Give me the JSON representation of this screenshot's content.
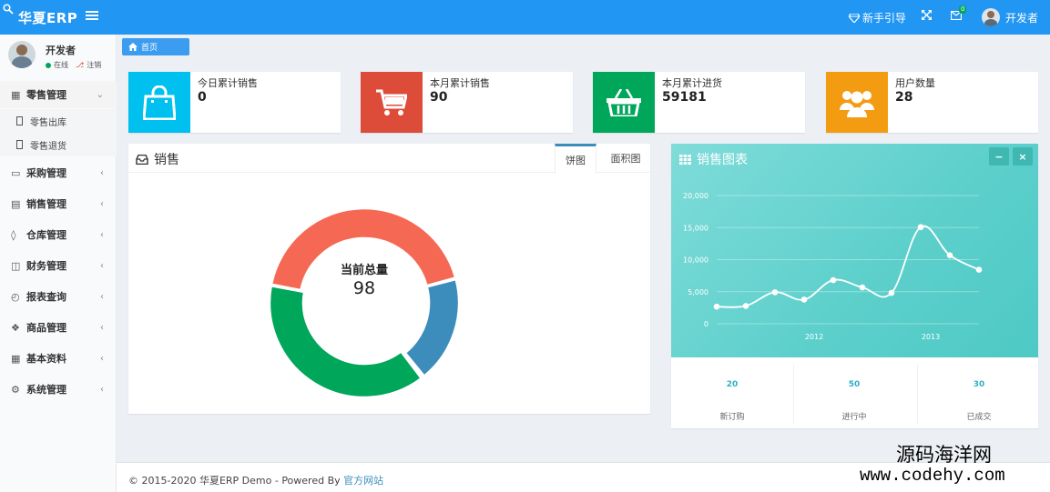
{
  "header": {
    "logo": "华夏ERP",
    "guide_label": "新手引导",
    "mail_badge": "0",
    "user_name": "开发者"
  },
  "sidebar": {
    "user": {
      "name": "开发者",
      "status": "在线",
      "logout": "注销"
    },
    "items": [
      {
        "label": "零售管理",
        "icon": "list-icon",
        "open": true
      },
      {
        "label": "采购管理",
        "icon": "monitor-icon"
      },
      {
        "label": "销售管理",
        "icon": "briefcase-icon"
      },
      {
        "label": "仓库管理",
        "icon": "layers-icon"
      },
      {
        "label": "财务管理",
        "icon": "map-icon"
      },
      {
        "label": "报表查询",
        "icon": "clock-icon"
      },
      {
        "label": "商品管理",
        "icon": "dropbox-icon"
      },
      {
        "label": "基本资料",
        "icon": "grid-icon"
      },
      {
        "label": "系统管理",
        "icon": "gear-icon"
      }
    ],
    "sub_items": [
      {
        "label": "零售出库"
      },
      {
        "label": "零售退货"
      }
    ]
  },
  "breadcrumb": {
    "label": "首页"
  },
  "info_boxes": [
    {
      "label": "今日累计销售",
      "value": "0",
      "color": "#00c0ef",
      "icon": "shopping-bag-icon"
    },
    {
      "label": "本月累计销售",
      "value": "90",
      "color": "#dd4b39",
      "icon": "shopping-cart-icon"
    },
    {
      "label": "本月累计进货",
      "value": "59181",
      "color": "#00a65a",
      "icon": "shopping-basket-icon"
    },
    {
      "label": "用户数量",
      "value": "28",
      "color": "#f39c12",
      "icon": "users-icon"
    }
  ],
  "sales_panel": {
    "title": "销售",
    "tabs": [
      "饼图",
      "面积图"
    ],
    "center_label": "当前总量",
    "center_value": "98"
  },
  "chart_panel": {
    "title": "销售图表",
    "min_btn": "−",
    "close_btn": "×",
    "stats": [
      {
        "value": "20",
        "label": "新订购"
      },
      {
        "value": "50",
        "label": "进行中"
      },
      {
        "value": "30",
        "label": "已成交"
      }
    ]
  },
  "chart_data": [
    {
      "type": "pie",
      "title": "",
      "slices": [
        {
          "value": 42,
          "color": "#f56954"
        },
        {
          "value": 18,
          "color": "#3c8dbc"
        },
        {
          "value": 38,
          "color": "#00a65a"
        }
      ]
    },
    {
      "type": "line",
      "title": "销售图表",
      "x_ticks": [
        "2012",
        "2013"
      ],
      "y_ticks": [
        "0",
        "5,000",
        "10,000",
        "15,000",
        "20,000"
      ],
      "ylim": [
        0,
        20000
      ],
      "values": [
        2666,
        2778,
        4912,
        3767,
        6810,
        5670,
        4820,
        15073,
        10687,
        8432
      ],
      "color": "#ffffff"
    }
  ],
  "footer": {
    "text": "© 2015-2020 华夏ERP Demo - Powered By ",
    "link": "官方网站"
  },
  "watermark": {
    "line1": "源码海洋网",
    "line2": "www.codehy.com"
  }
}
